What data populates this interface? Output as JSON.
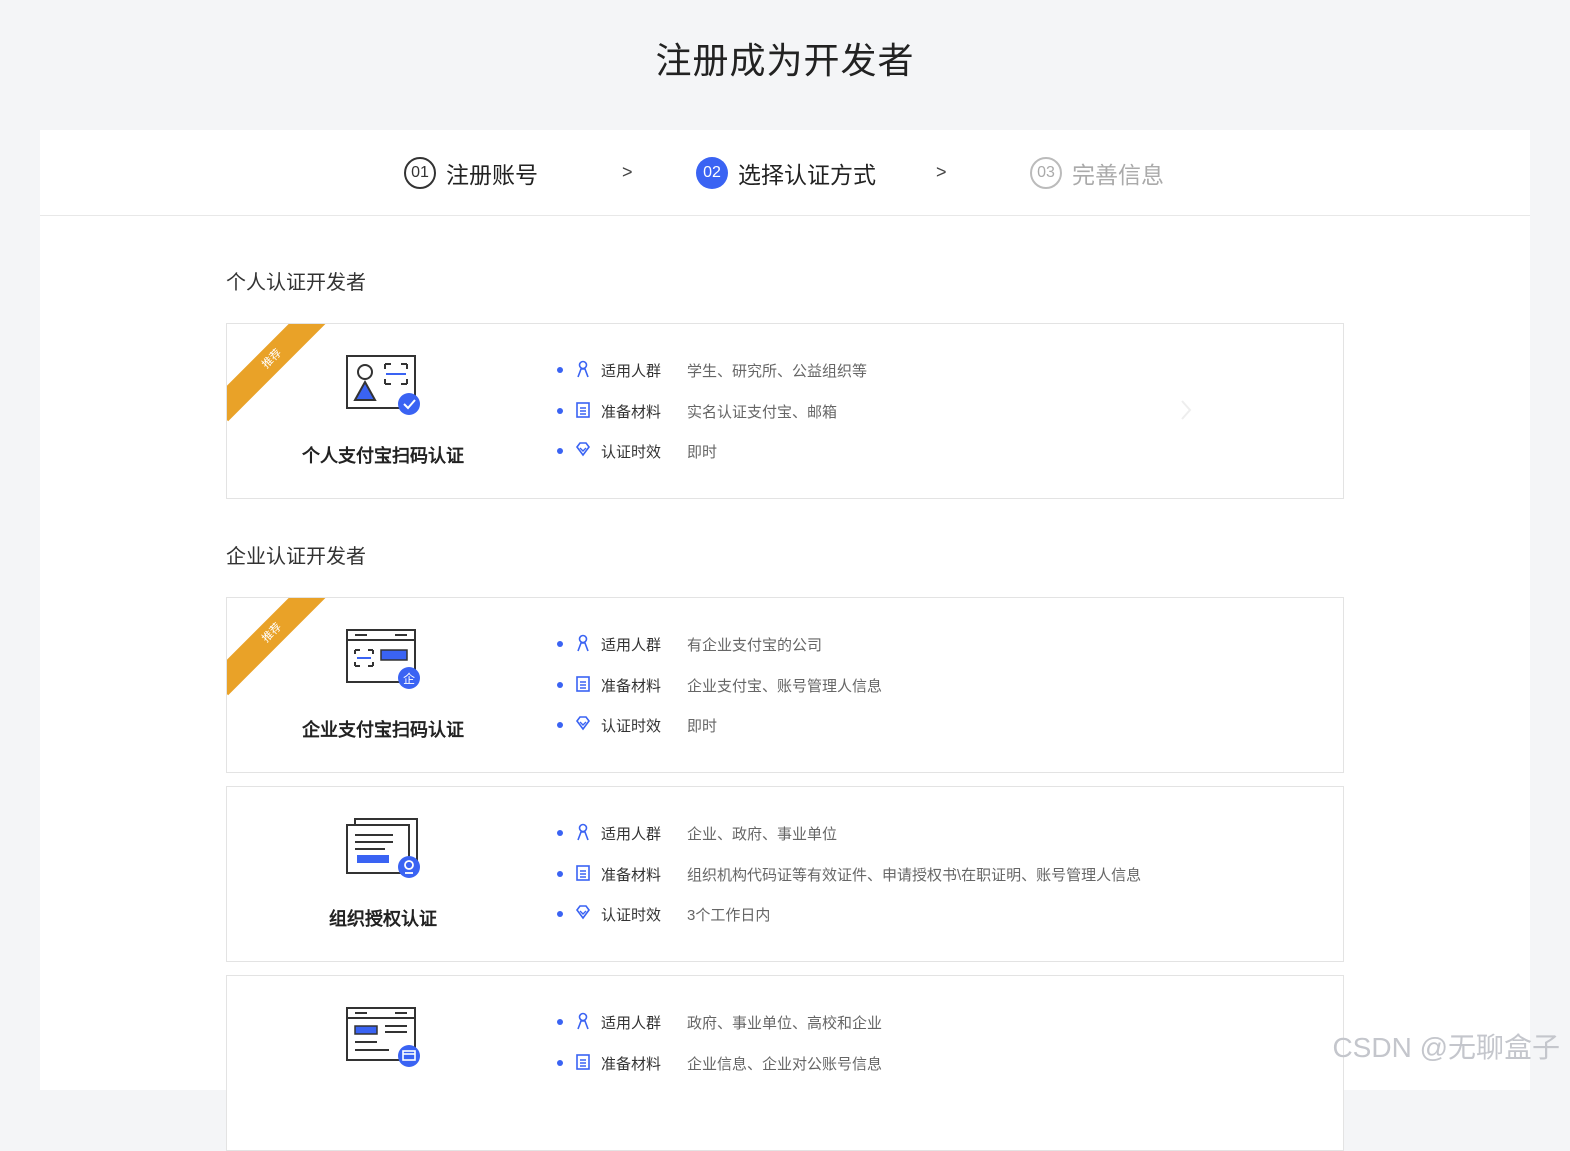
{
  "page": {
    "title": "注册成为开发者"
  },
  "steps": [
    {
      "num": "01",
      "label": "注册账号",
      "state": "done"
    },
    {
      "num": "02",
      "label": "选择认证方式",
      "state": "active"
    },
    {
      "num": "03",
      "label": "完善信息",
      "state": "todo"
    }
  ],
  "step_separator": ">",
  "sections": {
    "personal": {
      "title": "个人认证开发者"
    },
    "enterprise": {
      "title": "企业认证开发者"
    }
  },
  "row_labels": {
    "audience": "适用人群",
    "materials": "准备材料",
    "time": "认证时效"
  },
  "ribbon_text": "推荐",
  "cards": [
    {
      "name": "个人支付宝扫码认证",
      "recommended": true,
      "icon": "personal-scan-icon",
      "audience": "学生、研究所、公益组织等",
      "materials": "实名认证支付宝、邮箱",
      "time": "即时"
    },
    {
      "name": "企业支付宝扫码认证",
      "recommended": true,
      "icon": "enterprise-scan-icon",
      "audience": "有企业支付宝的公司",
      "materials": "企业支付宝、账号管理人信息",
      "time": "即时"
    },
    {
      "name": "组织授权认证",
      "recommended": false,
      "icon": "org-authorization-icon",
      "audience": "企业、政府、事业单位",
      "materials": "组织机构代码证等有效证件、申请授权书\\在职证明、账号管理人信息",
      "time": "3个工作日内"
    },
    {
      "name": "",
      "recommended": false,
      "icon": "bank-account-icon",
      "audience": "政府、事业单位、高校和企业",
      "materials": "企业信息、企业对公账号信息",
      "time": ""
    }
  ],
  "watermark": "CSDN @无聊盒子",
  "colors": {
    "accent": "#3a63f3",
    "ribbon": "#e9a228"
  }
}
